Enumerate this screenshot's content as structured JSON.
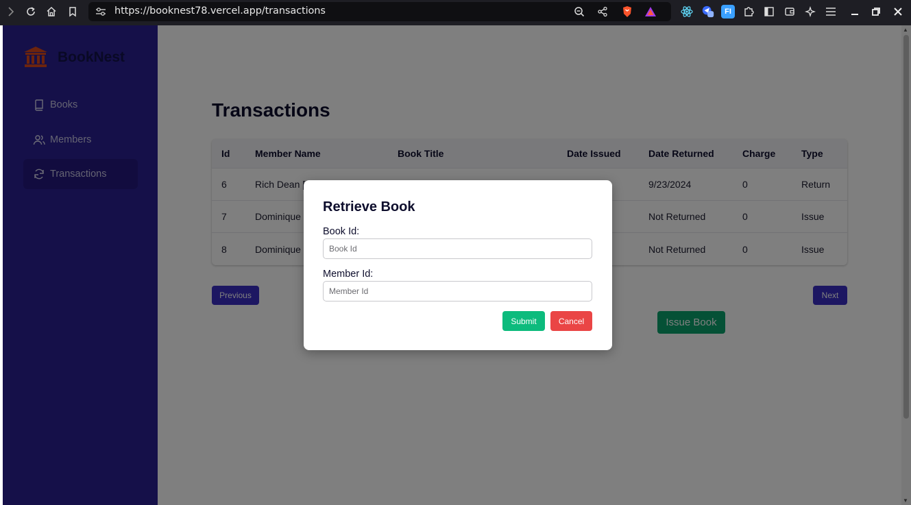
{
  "browser": {
    "url": "https://booknest78.vercel.app/transactions",
    "nav_icons": [
      "forward-icon",
      "reload-icon",
      "home-icon",
      "bookmark-icon"
    ],
    "toolbar_icons": [
      "zoom-icon",
      "share-icon",
      "brave-shield-icon",
      "brave-rewards-icon",
      "react-devtools-icon",
      "extension-icon",
      "fi-extension-icon",
      "extensions-puzzle-icon",
      "sidebar-icon",
      "wallet-icon",
      "leo-ai-icon",
      "menu-icon"
    ],
    "fi_label": "FI"
  },
  "sidebar": {
    "brand": "BookNest",
    "items": [
      {
        "label": "Books",
        "icon": "book-icon"
      },
      {
        "label": "Members",
        "icon": "users-icon"
      },
      {
        "label": "Transactions",
        "icon": "refresh-icon"
      }
    ]
  },
  "main": {
    "title": "Transactions",
    "table": {
      "headers": [
        "Id",
        "Member Name",
        "Book Title",
        "Date Issued",
        "Date Returned",
        "Charge",
        "Type"
      ],
      "rows": [
        {
          "id": "6",
          "member": "Rich Dean [1",
          "book": "",
          "issued": "",
          "returned": "9/23/2024",
          "charge": "0",
          "type": "Return"
        },
        {
          "id": "7",
          "member": "Dominique C",
          "book": "",
          "issued": "",
          "returned": "Not Returned",
          "charge": "0",
          "type": "Issue"
        },
        {
          "id": "8",
          "member": "Dominique C",
          "book": "",
          "issued": "",
          "returned": "Not Returned",
          "charge": "0",
          "type": "Issue"
        }
      ]
    },
    "previous_label": "Previous",
    "next_label": "Next",
    "issue_label": "Issue Book"
  },
  "modal": {
    "title": "Retrieve Book",
    "book_id_label": "Book Id:",
    "book_id_placeholder": "Book Id",
    "book_id_value": "",
    "member_id_label": "Member Id:",
    "member_id_placeholder": "Member Id",
    "member_id_value": "",
    "submit_label": "Submit",
    "cancel_label": "Cancel"
  },
  "colors": {
    "sidebar": "#2b2192",
    "primary_button": "#3b2fc4",
    "issue_button": "#0aa26c",
    "submit_button": "#0dbb7d",
    "cancel_button": "#ea4545",
    "logo": "#d9481c"
  }
}
